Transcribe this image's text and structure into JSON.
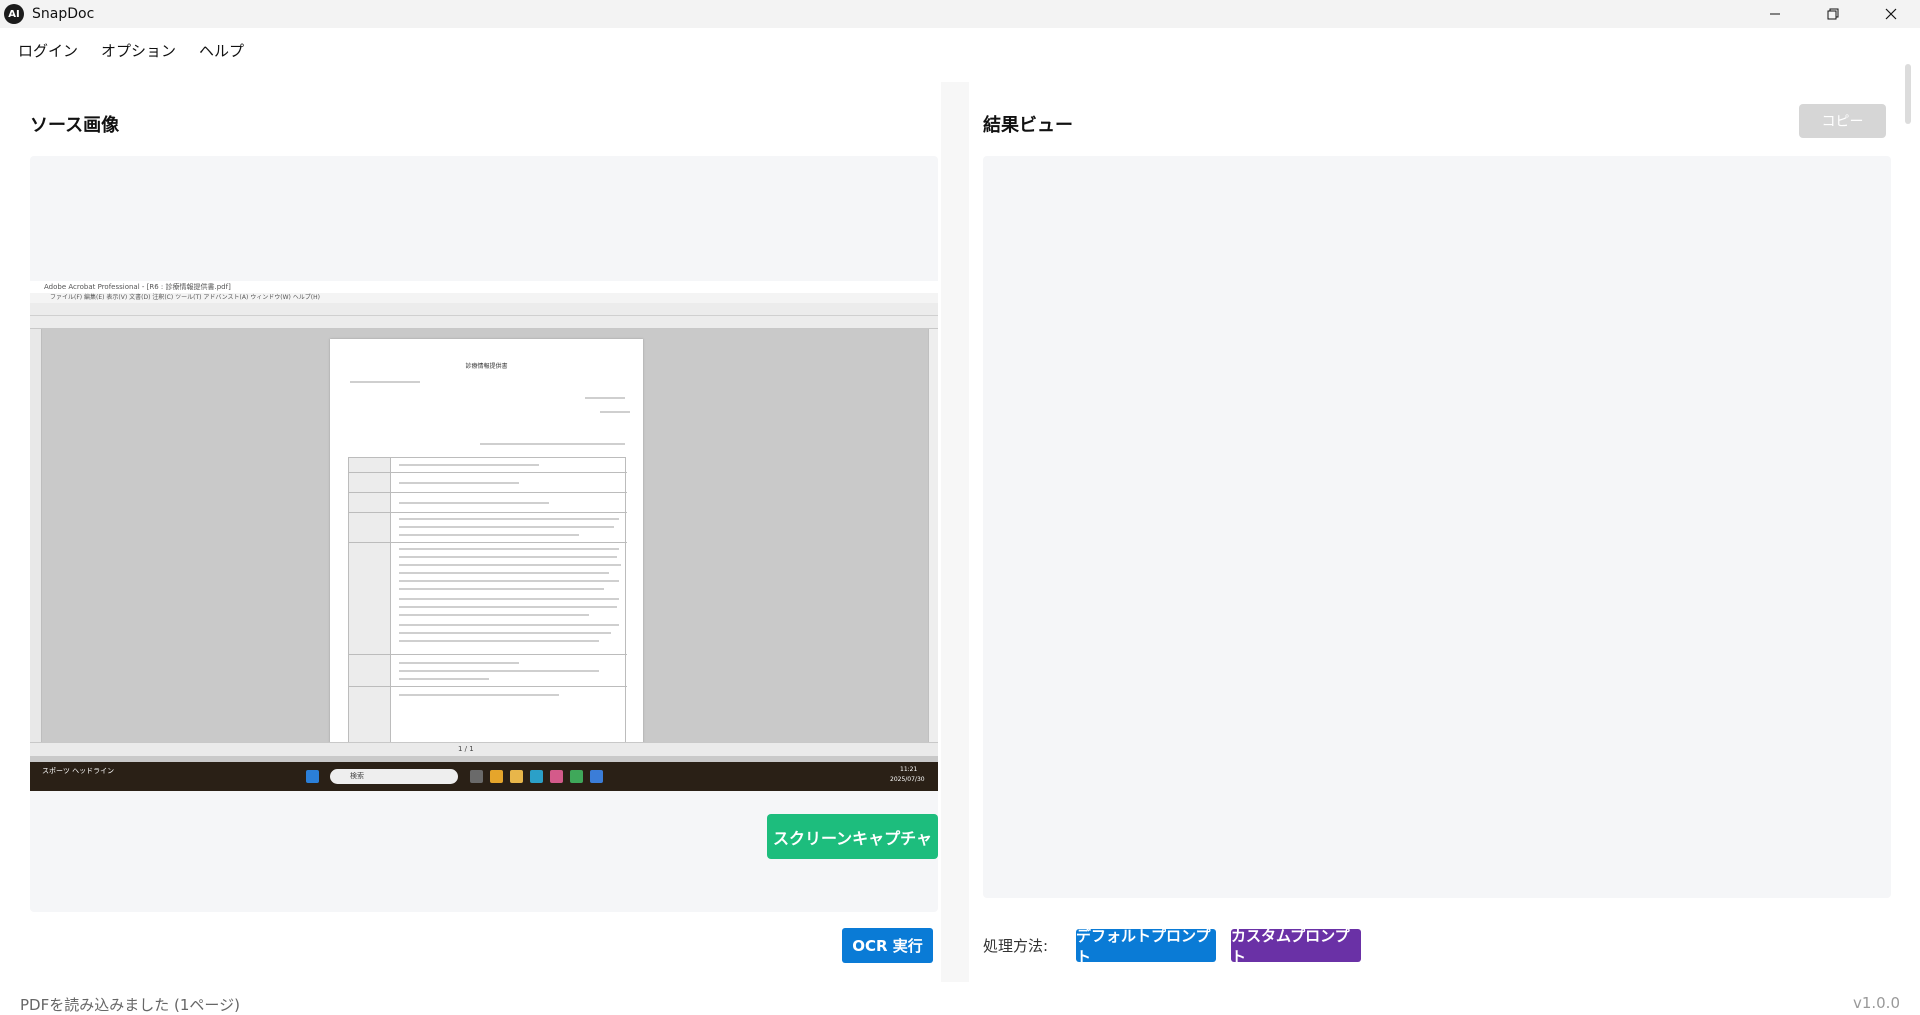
{
  "window": {
    "app_icon_text": "AI",
    "title": "SnapDoc"
  },
  "menu": [
    "ログイン",
    "オプション",
    "ヘルプ"
  ],
  "source": {
    "title": "ソース画像",
    "capture_button": "スクリーンキャプチャ",
    "ocr_button": "OCR 実行",
    "thumbnail": {
      "window_title": "Adobe Acrobat Professional - [R6 : 診療情報提供書.pdf]",
      "menu_text": "ファイル(F)  編集(E)  表示(V)  文書(D)  注釈(C)  ツール(T)  アドバンスト(A)  ウィンドウ(W)  ヘルプ(H)",
      "doc_title": "診療情報提供書",
      "taskbar_search": "検索",
      "taskbar_news": "スポーツ ヘッドライン",
      "taskbar_time": "11:21",
      "taskbar_date": "2025/07/30",
      "page_counter": "1 / 1"
    }
  },
  "result": {
    "title": "結果ビュー",
    "copy_button": "コピー",
    "method_label": "処理方法:",
    "default_prompt_button": "デフォルトプロンプト",
    "custom_prompt_button": "カスタムプロンプト"
  },
  "status": {
    "message": "PDFを読み込みました (1ページ)",
    "version": "v1.0.0"
  },
  "colors": {
    "capture": "#1dbd7d",
    "primary": "#0a7bd6",
    "custom": "#6a31a6",
    "copy_disabled": "#d6d6d6"
  }
}
